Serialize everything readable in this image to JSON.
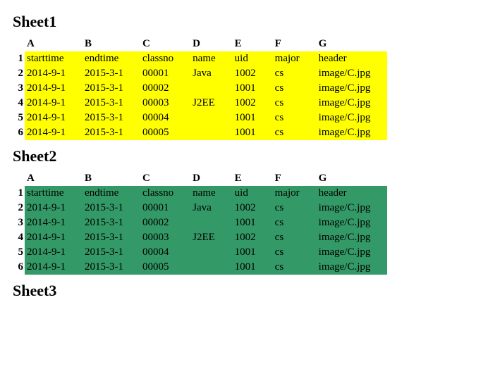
{
  "sheets": [
    {
      "title": "Sheet1",
      "colHeaders": [
        "A",
        "B",
        "C",
        "D",
        "E",
        "F",
        "G"
      ],
      "rowBgClass": "bg-yellow",
      "tight": false,
      "rows": [
        [
          "starttime",
          "endtime",
          "classno",
          "name",
          "uid",
          "major",
          "header"
        ],
        [
          "2014-9-1",
          "2015-3-1",
          "00001",
          "Java",
          "1002",
          "cs",
          "image/C.jpg"
        ],
        [
          "2014-9-1",
          "2015-3-1",
          "00002",
          "",
          "1001",
          "cs",
          "image/C.jpg"
        ],
        [
          "2014-9-1",
          "2015-3-1",
          "00003",
          "J2EE",
          "1002",
          "cs",
          "image/C.jpg"
        ],
        [
          "2014-9-1",
          "2015-3-1",
          "00004",
          "",
          "1001",
          "cs",
          "image/C.jpg"
        ],
        [
          "2014-9-1",
          "2015-3-1",
          "00005",
          "",
          "1001",
          "cs",
          "image/C.jpg"
        ]
      ]
    },
    {
      "title": "Sheet2",
      "colHeaders": [
        "A",
        "B",
        "C",
        "D",
        "E",
        "F",
        "G"
      ],
      "rowBgClass": "bg-green",
      "tight": true,
      "rows": [
        [
          "starttime",
          "endtime",
          "classno",
          "name",
          "uid",
          "major",
          "header"
        ],
        [
          "2014-9-1",
          "2015-3-1",
          "00001",
          "Java",
          "1002",
          "cs",
          "image/C.jpg"
        ],
        [
          "2014-9-1",
          "2015-3-1",
          "00002",
          "",
          "1001",
          "cs",
          "image/C.jpg"
        ],
        [
          "2014-9-1",
          "2015-3-1",
          "00003",
          "J2EE",
          "1002",
          "cs",
          "image/C.jpg"
        ],
        [
          "2014-9-1",
          "2015-3-1",
          "00004",
          "",
          "1001",
          "cs",
          "image/C.jpg"
        ],
        [
          "2014-9-1",
          "2015-3-1",
          "00005",
          "",
          "1001",
          "cs",
          "image/C.jpg"
        ]
      ]
    },
    {
      "title": "Sheet3",
      "colHeaders": [],
      "rowBgClass": "",
      "tight": false,
      "rows": []
    }
  ]
}
